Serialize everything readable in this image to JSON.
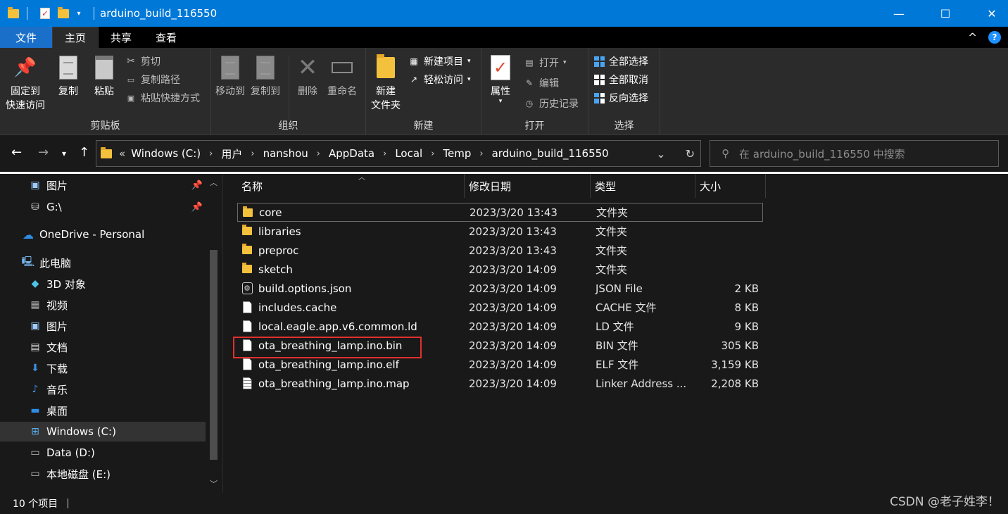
{
  "titlebar": {
    "title": "arduino_build_116550",
    "minimize": "—",
    "maximize": "☐",
    "close": "✕"
  },
  "tabs": {
    "file": "文件",
    "home": "主页",
    "share": "共享",
    "view": "查看",
    "collapse": "^",
    "help": "?"
  },
  "ribbon": {
    "clipboard": {
      "label": "剪贴板",
      "pin_quick": "固定到\n快速访问",
      "pin_quick_line1": "固定到",
      "pin_quick_line2": "快速访问",
      "copy": "复制",
      "paste": "粘贴",
      "cut": "剪切",
      "copy_path": "复制路径",
      "paste_shortcut": "粘贴快捷方式"
    },
    "organize": {
      "label": "组织",
      "move_to": "移动到",
      "copy_to": "复制到",
      "delete": "删除",
      "rename": "重命名"
    },
    "new": {
      "label": "新建",
      "new_folder_line1": "新建",
      "new_folder_line2": "文件夹",
      "new_item": "新建项目",
      "easy_access": "轻松访问"
    },
    "open": {
      "label": "打开",
      "properties": "属性",
      "open": "打开",
      "edit": "编辑",
      "history": "历史记录"
    },
    "select": {
      "label": "选择",
      "select_all": "全部选择",
      "select_none": "全部取消",
      "invert": "反向选择"
    }
  },
  "address": {
    "overflow": "«",
    "crumbs": [
      "Windows (C:)",
      "用户",
      "nanshou",
      "AppData",
      "Local",
      "Temp",
      "arduino_build_116550"
    ],
    "search_placeholder": "在 arduino_build_116550 中搜索"
  },
  "nav": {
    "items": [
      {
        "label": "图片",
        "icon": "pictures-icon",
        "pinned": true
      },
      {
        "label": "G:\\",
        "icon": "network-drive-icon",
        "pinned": true
      },
      {
        "label": "OneDrive - Personal",
        "icon": "onedrive-cloud-icon"
      },
      {
        "label": "此电脑",
        "icon": "this-pc-icon"
      },
      {
        "label": "3D 对象",
        "icon": "3d-objects-icon"
      },
      {
        "label": "视频",
        "icon": "videos-icon"
      },
      {
        "label": "图片",
        "icon": "pictures-icon"
      },
      {
        "label": "文档",
        "icon": "documents-icon"
      },
      {
        "label": "下载",
        "icon": "downloads-icon"
      },
      {
        "label": "音乐",
        "icon": "music-icon"
      },
      {
        "label": "桌面",
        "icon": "desktop-icon"
      },
      {
        "label": "Windows (C:)",
        "icon": "windows-drive-icon",
        "selected": true
      },
      {
        "label": "Data (D:)",
        "icon": "drive-icon"
      },
      {
        "label": "本地磁盘 (E:)",
        "icon": "drive-icon"
      }
    ]
  },
  "columns": {
    "name": "名称",
    "date": "修改日期",
    "type": "类型",
    "size": "大小"
  },
  "files": [
    {
      "name": "core",
      "date": "2023/3/20 13:43",
      "type": "文件夹",
      "size": "",
      "icon": "folder-icon"
    },
    {
      "name": "libraries",
      "date": "2023/3/20 13:43",
      "type": "文件夹",
      "size": "",
      "icon": "folder-icon"
    },
    {
      "name": "preproc",
      "date": "2023/3/20 13:43",
      "type": "文件夹",
      "size": "",
      "icon": "folder-icon"
    },
    {
      "name": "sketch",
      "date": "2023/3/20 14:09",
      "type": "文件夹",
      "size": "",
      "icon": "folder-icon"
    },
    {
      "name": "build.options.json",
      "date": "2023/3/20 14:09",
      "type": "JSON File",
      "size": "2 KB",
      "icon": "json-file-icon"
    },
    {
      "name": "includes.cache",
      "date": "2023/3/20 14:09",
      "type": "CACHE 文件",
      "size": "8 KB",
      "icon": "file-icon"
    },
    {
      "name": "local.eagle.app.v6.common.ld",
      "date": "2023/3/20 14:09",
      "type": "LD 文件",
      "size": "9 KB",
      "icon": "file-icon"
    },
    {
      "name": "ota_breathing_lamp.ino.bin",
      "date": "2023/3/20 14:09",
      "type": "BIN 文件",
      "size": "305 KB",
      "icon": "file-icon"
    },
    {
      "name": "ota_breathing_lamp.ino.elf",
      "date": "2023/3/20 14:09",
      "type": "ELF 文件",
      "size": "3,159 KB",
      "icon": "file-icon"
    },
    {
      "name": "ota_breathing_lamp.ino.map",
      "date": "2023/3/20 14:09",
      "type": "Linker Address ...",
      "size": "2,208 KB",
      "icon": "text-file-icon"
    }
  ],
  "status": {
    "count": "10 个项目"
  },
  "watermark": "CSDN @老子姓李！",
  "colors": {
    "titlebar": "#0078d7",
    "file_tab": "#1a6fc9",
    "background": "#191919",
    "ribbon": "#2b2b2b",
    "highlight_box": "#e0312b",
    "folder": "#f4c13d"
  }
}
